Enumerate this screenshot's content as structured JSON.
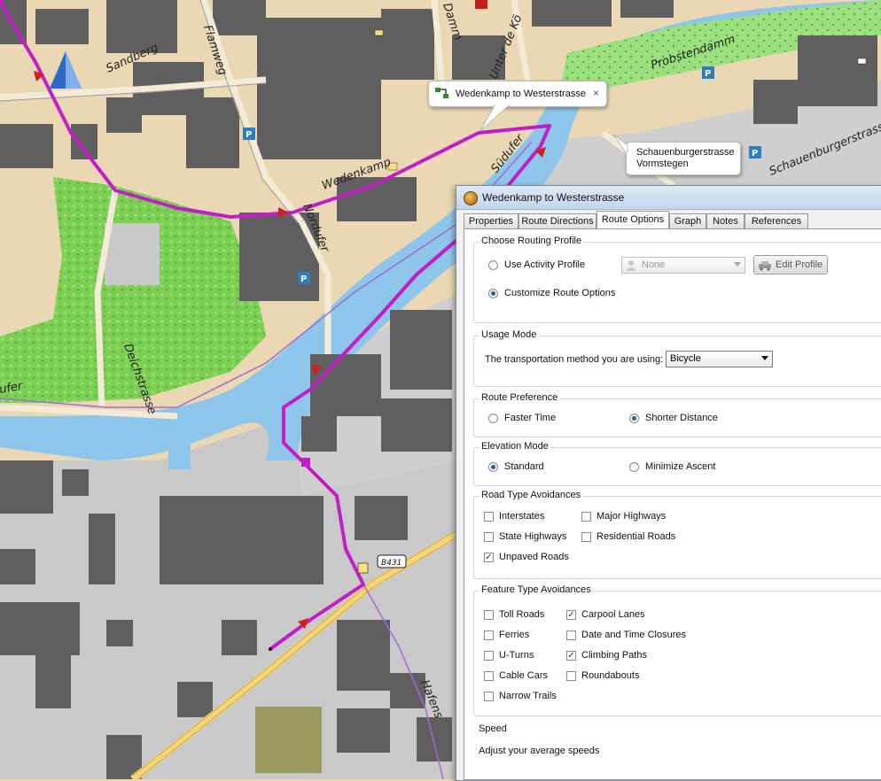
{
  "map": {
    "streets": [
      "Sandberg",
      "Flamweg",
      "Damm",
      "Unter de Kö",
      "Probstendamm",
      "Schauenburgerstrasse",
      "Wedenkamp",
      "Nordufer",
      "Südufer",
      "Deichstrasse",
      "ufer",
      "Hafens"
    ],
    "road_shield": "B431",
    "colors": {
      "route": "#c21ec6",
      "water": "#8ec5ea",
      "park": "#7ccf53",
      "built": "#5f5f5f",
      "land": "#e9d8b3",
      "industrial": "#c8c8c8"
    }
  },
  "callouts": {
    "route_name": "Wedenkamp to Westerstrasse",
    "close_glyph": "×",
    "place_line1": "Schauenburgerstrasse",
    "place_line2": "Vormstegen"
  },
  "dialog": {
    "title": "Wedenkamp to Westerstrasse",
    "tabs": [
      "Properties",
      "Route Directions",
      "Route Options",
      "Graph",
      "Notes",
      "References"
    ],
    "active_tab": "Route Options",
    "routing_profile": {
      "title": "Choose Routing Profile",
      "use_activity_label": "Use Activity Profile",
      "profile_value": "None",
      "edit_profile_label": "Edit Profile",
      "customize_label": "Customize Route Options",
      "selected": "Customize Route Options"
    },
    "usage_mode": {
      "title": "Usage Mode",
      "prompt": "The transportation method you are using:",
      "value": "Bicycle"
    },
    "route_preference": {
      "title": "Route Preference",
      "options": [
        "Faster Time",
        "Shorter Distance"
      ],
      "selected": "Shorter Distance"
    },
    "elevation_mode": {
      "title": "Elevation Mode",
      "options": [
        "Standard",
        "Minimize Ascent"
      ],
      "selected": "Standard"
    },
    "road_type": {
      "title": "Road Type Avoidances",
      "items": [
        {
          "label": "Interstates",
          "checked": false
        },
        {
          "label": "Major Highways",
          "checked": false
        },
        {
          "label": "State Highways",
          "checked": false
        },
        {
          "label": "Residential Roads",
          "checked": false
        },
        {
          "label": "Unpaved Roads",
          "checked": true
        }
      ]
    },
    "feature_type": {
      "title": "Feature Type Avoidances",
      "items": [
        {
          "label": "Toll Roads",
          "checked": false
        },
        {
          "label": "Carpool Lanes",
          "checked": true
        },
        {
          "label": "Ferries",
          "checked": false
        },
        {
          "label": "Date and Time Closures",
          "checked": false
        },
        {
          "label": "U-Turns",
          "checked": false
        },
        {
          "label": "Climbing Paths",
          "checked": true
        },
        {
          "label": "Cable Cars",
          "checked": false
        },
        {
          "label": "Roundabouts",
          "checked": false
        },
        {
          "label": "Narrow Trails",
          "checked": false
        }
      ]
    },
    "speed": {
      "title": "Speed",
      "subtitle": "Adjust your average speeds"
    }
  }
}
